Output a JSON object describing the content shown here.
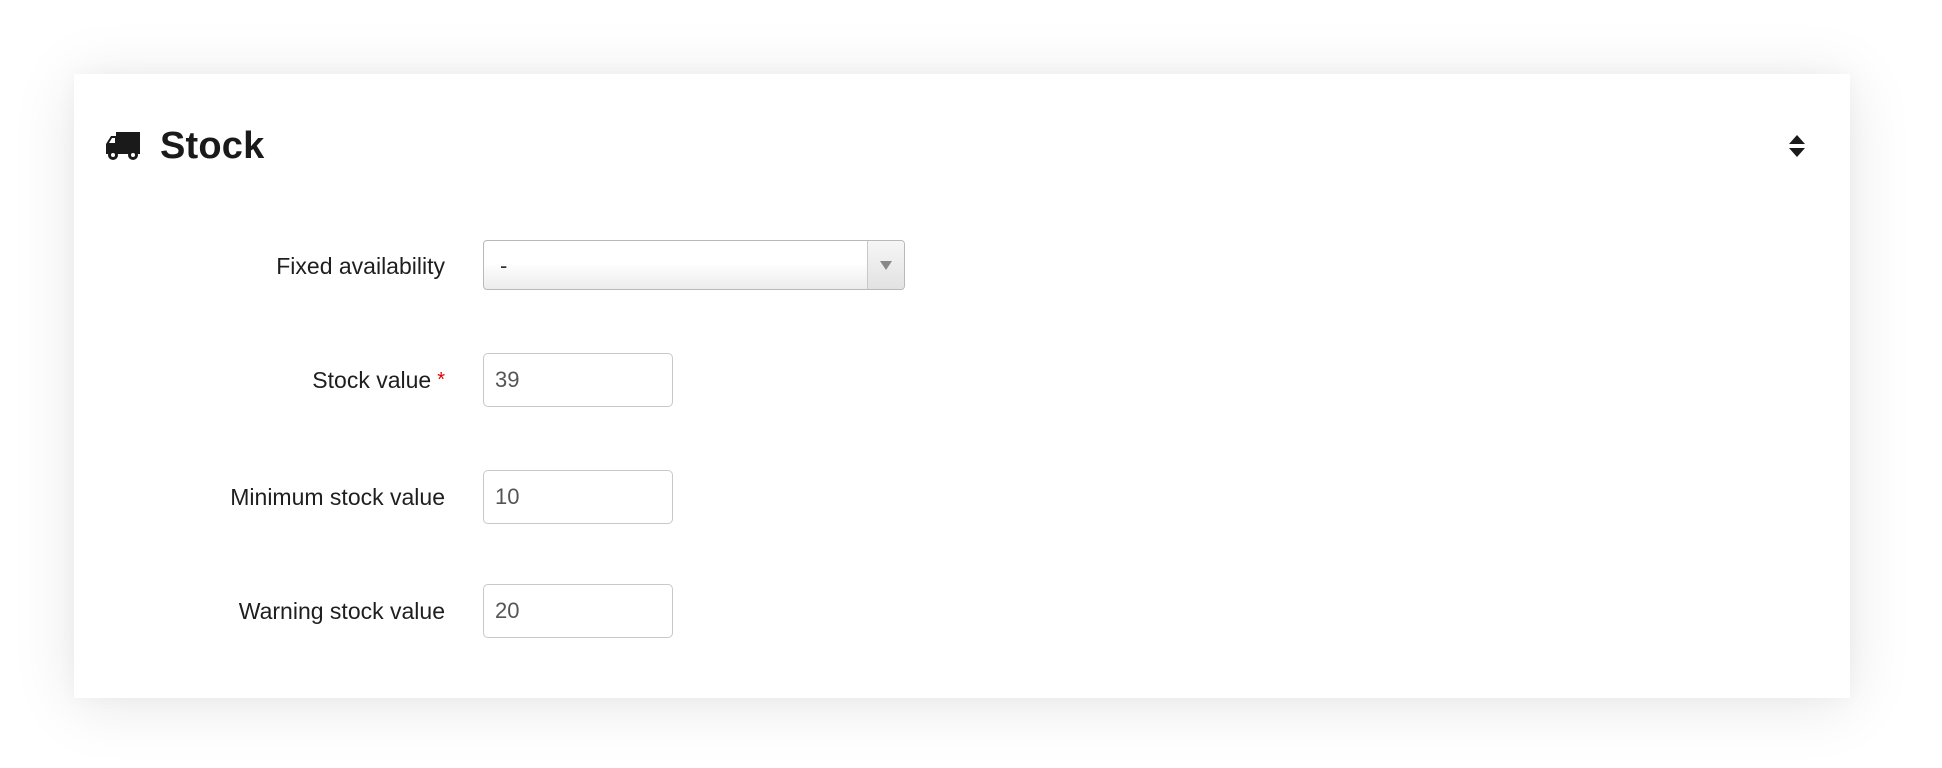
{
  "panel": {
    "title": "Stock",
    "icon": "truck-icon",
    "toggle_icon": "sort-icon"
  },
  "fields": {
    "fixed_availability": {
      "label": "Fixed availability",
      "selected": "-"
    },
    "stock_value": {
      "label": "Stock value",
      "required_mark": "*",
      "value": "39"
    },
    "minimum_stock_value": {
      "label": "Minimum stock value",
      "value": "10"
    },
    "warning_stock_value": {
      "label": "Warning stock value",
      "value": "20"
    }
  },
  "colors": {
    "required": "#e00000",
    "title": "#1a1a1a"
  }
}
